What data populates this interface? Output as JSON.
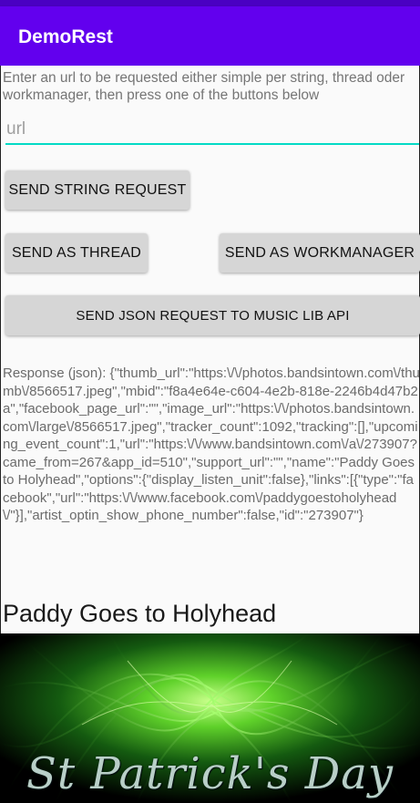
{
  "app": {
    "title": "DemoRest"
  },
  "form": {
    "instructions": "Enter an url to be requested either simple per string, thread oder workmanager, then press one of the buttons below",
    "url_placeholder": "url",
    "url_value": ""
  },
  "buttons": {
    "send_string": "SEND STRING REQUEST",
    "send_thread": "SEND AS THREAD",
    "send_workmanager": "SEND AS WORKMANAGER",
    "send_json": "SEND JSON REQUEST TO MUSIC LIB API"
  },
  "response": {
    "text": "Response (json): {\"thumb_url\":\"https:\\/\\/photos.bandsintown.com\\/thumb\\/8566517.jpeg\",\"mbid\":\"f8a4e64e-c604-4e2b-818e-2246b4d47b2a\",\"facebook_page_url\":\"\",\"image_url\":\"https:\\/\\/photos.bandsintown.com\\/large\\/8566517.jpeg\",\"tracker_count\":1092,\"tracking\":[],\"upcoming_event_count\":1,\"url\":\"https:\\/\\/www.bandsintown.com\\/a\\/273907?came_from=267&app_id=510\",\"support_url\":\"\",\"name\":\"Paddy Goes to Holyhead\",\"options\":{\"display_listen_unit\":false},\"links\":[{\"type\":\"facebook\",\"url\":\"https:\\/\\/www.facebook.com\\/paddygoestoholyhead\\/\"}],\"artist_optin_show_phone_number\":false,\"id\":\"273907\"}"
  },
  "artist": {
    "name": "Paddy Goes to Holyhead",
    "image_caption": "St Patrick's Day"
  },
  "colors": {
    "app_bar": "#6200ee",
    "status_bar": "#4a00c2",
    "input_underline": "#03dac5",
    "button_bg": "#d6d6d6"
  }
}
